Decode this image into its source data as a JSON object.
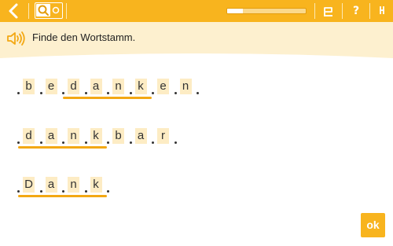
{
  "toolbar": {
    "back_icon": "chevron-left-icon",
    "mode_icon": "magnifier-switch-icon",
    "progress": 0.2,
    "help_label": "?",
    "flag_icon": "flag-icon",
    "menu_icon": "menu-icon"
  },
  "instruction": {
    "text": "Finde den Wortstamm."
  },
  "words": [
    {
      "letters": [
        "b",
        "e",
        "d",
        "a",
        "n",
        "k",
        "e",
        "n"
      ],
      "stem": [
        2,
        5
      ]
    },
    {
      "letters": [
        "d",
        "a",
        "n",
        "k",
        "b",
        "a",
        "r"
      ],
      "stem": [
        0,
        3
      ]
    },
    {
      "letters": [
        "D",
        "a",
        "n",
        "k"
      ],
      "stem": [
        0,
        3
      ]
    }
  ],
  "ok_label": "ok",
  "colors": {
    "accent": "#f8b41e",
    "tile": "#fdecc4",
    "band": "#fdf0cf"
  }
}
